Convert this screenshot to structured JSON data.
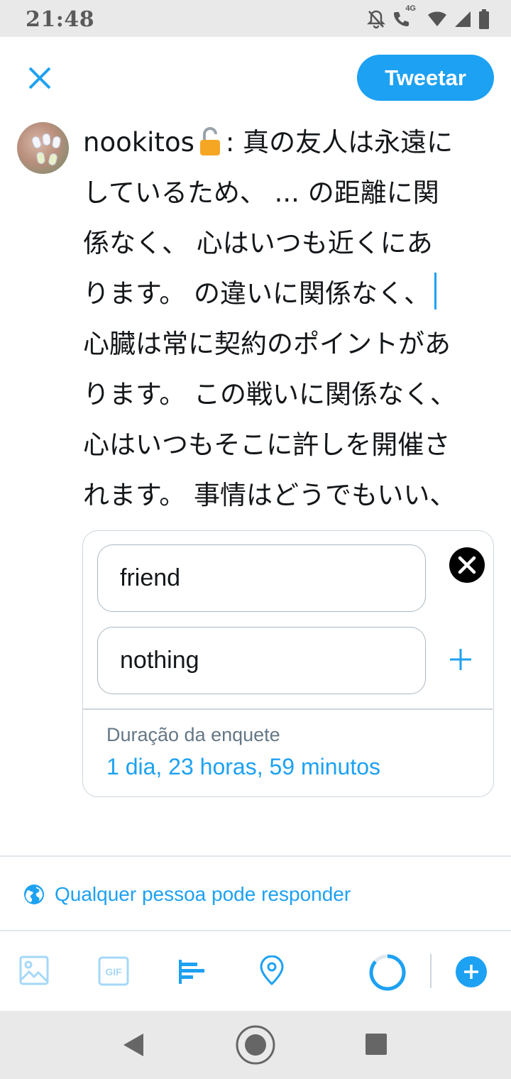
{
  "status_bar": {
    "time": "21:48",
    "network": "4G",
    "icons": [
      "mute-bell-icon",
      "wifi-call-icon",
      "wifi-icon",
      "signal-icon",
      "battery-icon"
    ]
  },
  "header": {
    "close_icon": "close-icon",
    "tweet_button": "Tweetar"
  },
  "composer": {
    "username": "nookitos",
    "lock_emoji": "open-lock-icon",
    "lines": [
      ": 真の友人は永遠に",
      "しているため、 ... の距離に関",
      "係なく、 心はいつも近くにあ",
      "ります。 の違いに関係なく、",
      "心臓は常に契約のポイントがあ",
      "ります。 この戦いに関係なく、",
      "心はいつもそこに許しを開催さ",
      "れます。 事情はどうでもいい、"
    ]
  },
  "poll": {
    "choices": [
      "friend",
      "nothing"
    ],
    "duration_label": "Duração da enquete",
    "duration_value": "1 dia, 23 horas, 59 minutos"
  },
  "reply_setting": {
    "icon": "globe-icon",
    "label": "Qualquer pessoa pode responder"
  },
  "toolbar": {
    "tools": [
      "image-icon",
      "gif-icon",
      "poll-icon",
      "location-icon",
      "character-counter",
      "add-tweet-icon"
    ],
    "gif_text": "GIF"
  },
  "nav": {
    "buttons": [
      "back-icon",
      "home-icon",
      "recents-icon"
    ]
  },
  "colors": {
    "accent": "#1da1f2",
    "text": "#14171a",
    "muted": "#657786",
    "border": "#ccd6dd",
    "system_bar": "#e9e9e9"
  }
}
